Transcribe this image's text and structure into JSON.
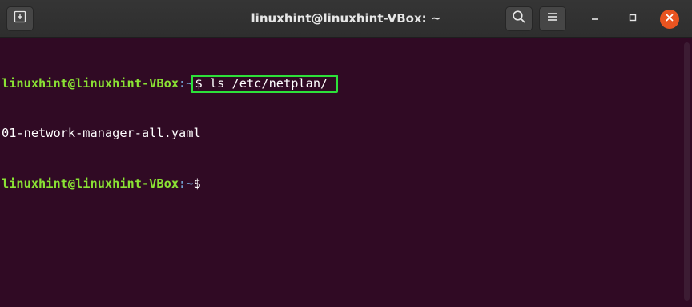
{
  "window": {
    "title": "linuxhint@linuxhint-VBox: ~",
    "buttons": {
      "new_tab_icon": "new-tab-icon",
      "search_icon": "search-icon",
      "menu_icon": "hamburger-menu-icon",
      "minimize_icon": "minimize-icon",
      "maximize_icon": "maximize-icon",
      "close_icon": "close-icon"
    },
    "colors": {
      "terminal_bg": "#300a24",
      "prompt_user": "#8ae234",
      "prompt_path": "#729fcf",
      "highlight_box": "#2de03a",
      "close_button": "#e95420"
    }
  },
  "terminal": {
    "lines": [
      {
        "user": "linuxhint@linuxhint-VBox",
        "sep": ":",
        "path": "~",
        "command": "$ ls /etc/netplan/"
      },
      {
        "output": "01-network-manager-all.yaml"
      },
      {
        "user": "linuxhint@linuxhint-VBox",
        "sep": ":",
        "path": "~",
        "command": "$ "
      }
    ]
  }
}
